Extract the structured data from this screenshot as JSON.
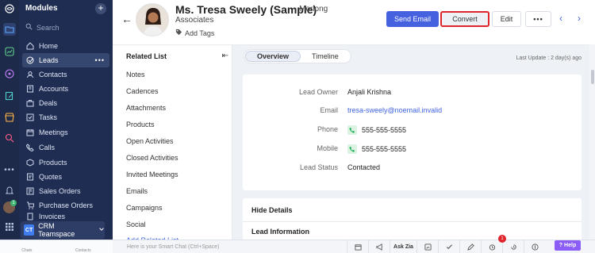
{
  "sidebar": {
    "title": "Modules",
    "search_placeholder": "Search",
    "items": [
      {
        "label": "Home",
        "icon": "home-icon"
      },
      {
        "label": "Leads",
        "icon": "leads-icon",
        "active": true
      },
      {
        "label": "Contacts",
        "icon": "contacts-icon"
      },
      {
        "label": "Accounts",
        "icon": "accounts-icon"
      },
      {
        "label": "Deals",
        "icon": "deals-icon"
      },
      {
        "label": "Tasks",
        "icon": "tasks-icon"
      },
      {
        "label": "Meetings",
        "icon": "meetings-icon"
      },
      {
        "label": "Calls",
        "icon": "calls-icon"
      },
      {
        "label": "Products",
        "icon": "products-icon"
      },
      {
        "label": "Quotes",
        "icon": "quotes-icon"
      },
      {
        "label": "Sales Orders",
        "icon": "sales-orders-icon"
      },
      {
        "label": "Purchase Orders",
        "icon": "purchase-orders-icon"
      },
      {
        "label": "Invoices",
        "icon": "invoices-icon"
      }
    ],
    "teamspace_badge": "CT",
    "teamspace_label": "CRM Teamspace",
    "rail_notification_count": "1"
  },
  "header": {
    "name": "Ms. Tresa Sweely (Sample)",
    "company_part1": "- Morlong",
    "company_part2": "Associates",
    "add_tags": "Add Tags",
    "send_email": "Send Email",
    "convert": "Convert",
    "edit": "Edit",
    "more": "•••"
  },
  "related_list": {
    "title": "Related List",
    "items": [
      "Notes",
      "Cadences",
      "Attachments",
      "Products",
      "Open Activities",
      "Closed Activities",
      "Invited Meetings",
      "Emails",
      "Campaigns",
      "Social"
    ],
    "add_link": "Add Related List"
  },
  "main": {
    "tabs": [
      "Overview",
      "Timeline"
    ],
    "last_update": "Last Update : 2 day(s) ago",
    "fields": [
      {
        "label": "Lead Owner",
        "value": "Anjali Krishna"
      },
      {
        "label": "Email",
        "value": "tresa-sweely@noemail.invalid"
      },
      {
        "label": "Phone",
        "value": "555-555-5555"
      },
      {
        "label": "Mobile",
        "value": "555-555-5555"
      },
      {
        "label": "Lead Status",
        "value": "Contacted"
      }
    ],
    "hide_details": "Hide Details",
    "lead_information": "Lead Information"
  },
  "bottom_bar": {
    "chats": "Chats",
    "contacts": "Contacts",
    "smart_chat_placeholder": "Here is your Smart Chat (Ctrl+Space)",
    "ask_zia": "Ask Zia",
    "notification_count": "1",
    "help": "Help"
  },
  "colors": {
    "sidebar_bg": "#1f2d52",
    "rail_bg": "#1d2a4a",
    "primary_button": "#4561e0",
    "highlight_border": "#e0242b",
    "help_button": "#8b5cf6"
  }
}
